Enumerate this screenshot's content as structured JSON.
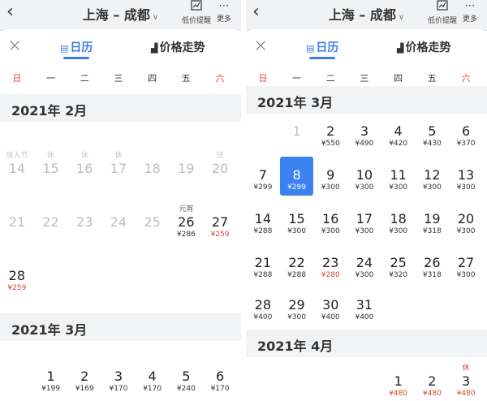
{
  "left": {
    "header": {
      "back_icon": "‹",
      "route": "上海 – 成都",
      "route_chevron": "∨",
      "tool1_label": "低价提醒",
      "tool1_icon": "chart-icon",
      "tool2_label": "更多",
      "tool2_icon": "⋯"
    },
    "sheet": {
      "close_icon": "×",
      "tab_calendar": "日历",
      "tab_trend": "价格走势"
    },
    "weekdays": [
      "日",
      "一",
      "二",
      "三",
      "四",
      "五",
      "六"
    ],
    "month1": {
      "title": "2021年 2月"
    },
    "feb": [
      {
        "hol": "情人节",
        "num": "14",
        "price": ""
      },
      {
        "hol": "休",
        "num": "15",
        "price": ""
      },
      {
        "hol": "休",
        "num": "16",
        "price": ""
      },
      {
        "hol": "休",
        "num": "17",
        "price": ""
      },
      {
        "hol": "",
        "num": "18",
        "price": ""
      },
      {
        "hol": "",
        "num": "19",
        "price": ""
      },
      {
        "hol": "班",
        "num": "20",
        "price": ""
      },
      {
        "hol": "",
        "num": "21",
        "price": ""
      },
      {
        "hol": "",
        "num": "22",
        "price": ""
      },
      {
        "hol": "",
        "num": "23",
        "price": ""
      },
      {
        "hol": "",
        "num": "24",
        "price": ""
      },
      {
        "hol": "",
        "num": "25",
        "price": ""
      },
      {
        "hol": "元宵",
        "num": "26",
        "price": "¥286"
      },
      {
        "hol": "",
        "num": "27",
        "price": "¥259"
      },
      {
        "hol": "",
        "num": "28",
        "price": "¥259"
      }
    ],
    "month2": {
      "title": "2021年 3月"
    },
    "mar": [
      {
        "num": "1",
        "price": "¥199"
      },
      {
        "num": "2",
        "price": "¥169"
      },
      {
        "num": "3",
        "price": "¥170"
      },
      {
        "num": "4",
        "price": "¥170"
      },
      {
        "num": "5",
        "price": "¥240"
      },
      {
        "num": "6",
        "price": "¥170"
      }
    ]
  },
  "right": {
    "header": {
      "back_icon": "‹",
      "route": "上海 – 成都",
      "route_chevron": "∨",
      "tool1_label": "低价提醒",
      "tool2_label": "更多",
      "tool2_icon": "⋯"
    },
    "sheet": {
      "close_icon": "×",
      "tab_calendar": "日历",
      "tab_trend": "价格走势"
    },
    "weekdays": [
      "日",
      "一",
      "二",
      "三",
      "四",
      "五",
      "六"
    ],
    "month1": {
      "title": "2021年 3月"
    },
    "mar": [
      {
        "num": "1",
        "price": ""
      },
      {
        "num": "2",
        "price": "¥550"
      },
      {
        "num": "3",
        "price": "¥490"
      },
      {
        "num": "4",
        "price": "¥420"
      },
      {
        "num": "5",
        "price": "¥430"
      },
      {
        "num": "6",
        "price": "¥370"
      },
      {
        "num": "7",
        "price": "¥299"
      },
      {
        "num": "8",
        "price": "¥299"
      },
      {
        "num": "9",
        "price": "¥300"
      },
      {
        "num": "10",
        "price": "¥300"
      },
      {
        "num": "11",
        "price": "¥300"
      },
      {
        "num": "12",
        "price": "¥300"
      },
      {
        "num": "13",
        "price": "¥300"
      },
      {
        "num": "14",
        "price": "¥288"
      },
      {
        "num": "15",
        "price": "¥300"
      },
      {
        "num": "16",
        "price": "¥300"
      },
      {
        "num": "17",
        "price": "¥300"
      },
      {
        "num": "18",
        "price": "¥300"
      },
      {
        "num": "19",
        "price": "¥318"
      },
      {
        "num": "20",
        "price": "¥300"
      },
      {
        "num": "21",
        "price": "¥288"
      },
      {
        "num": "22",
        "price": "¥288"
      },
      {
        "num": "23",
        "price": "¥280"
      },
      {
        "num": "24",
        "price": "¥300"
      },
      {
        "num": "25",
        "price": "¥320"
      },
      {
        "num": "26",
        "price": "¥318"
      },
      {
        "num": "27",
        "price": "¥300"
      },
      {
        "num": "28",
        "price": "¥400"
      },
      {
        "num": "29",
        "price": "¥300"
      },
      {
        "num": "30",
        "price": "¥400"
      },
      {
        "num": "31",
        "price": "¥400"
      }
    ],
    "month2": {
      "title": "2021年 4月"
    },
    "apr": [
      {
        "hol": "",
        "num": "1",
        "price": "¥480"
      },
      {
        "hol": "",
        "num": "2",
        "price": "¥480"
      },
      {
        "hol": "休",
        "num": "3",
        "price": "¥480"
      }
    ]
  }
}
